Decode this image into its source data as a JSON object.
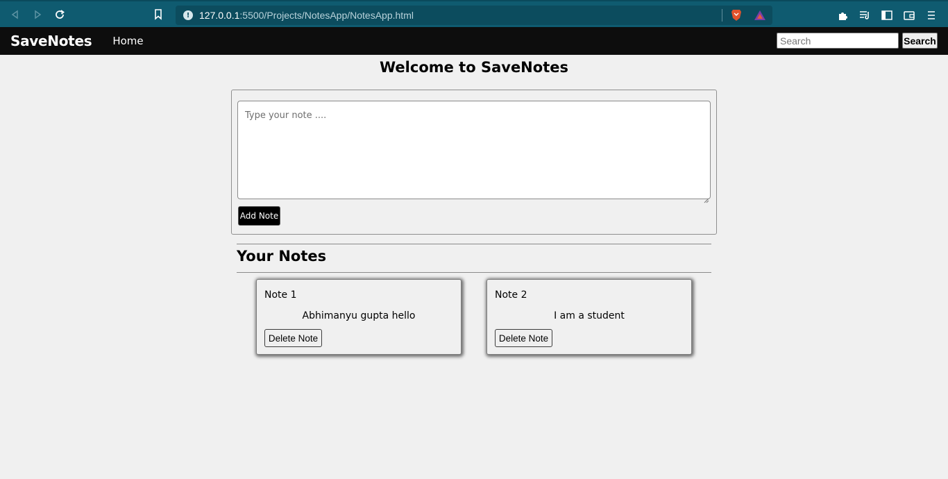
{
  "browser": {
    "url_host": "127.0.0.1",
    "url_rest": ":5500/Projects/NotesApp/NotesApp.html"
  },
  "navbar": {
    "brand": "SaveNotes",
    "home_label": "Home",
    "search_placeholder": "Search",
    "search_button_label": "Search"
  },
  "main": {
    "title": "Welcome to SaveNotes",
    "note_placeholder": "Type your note ....",
    "add_button_label": "Add Note",
    "notes_heading": "Your Notes"
  },
  "notes": [
    {
      "title": "Note 1",
      "text": "Abhimanyu gupta hello",
      "delete_label": "Delete Note"
    },
    {
      "title": "Note 2",
      "text": "I am a student",
      "delete_label": "Delete Note"
    }
  ],
  "colors": {
    "browser_chrome": "#0f5b70",
    "navbar_bg": "#0d0d0d",
    "page_bg": "#f0f0f0",
    "add_button_bg": "#000000"
  }
}
